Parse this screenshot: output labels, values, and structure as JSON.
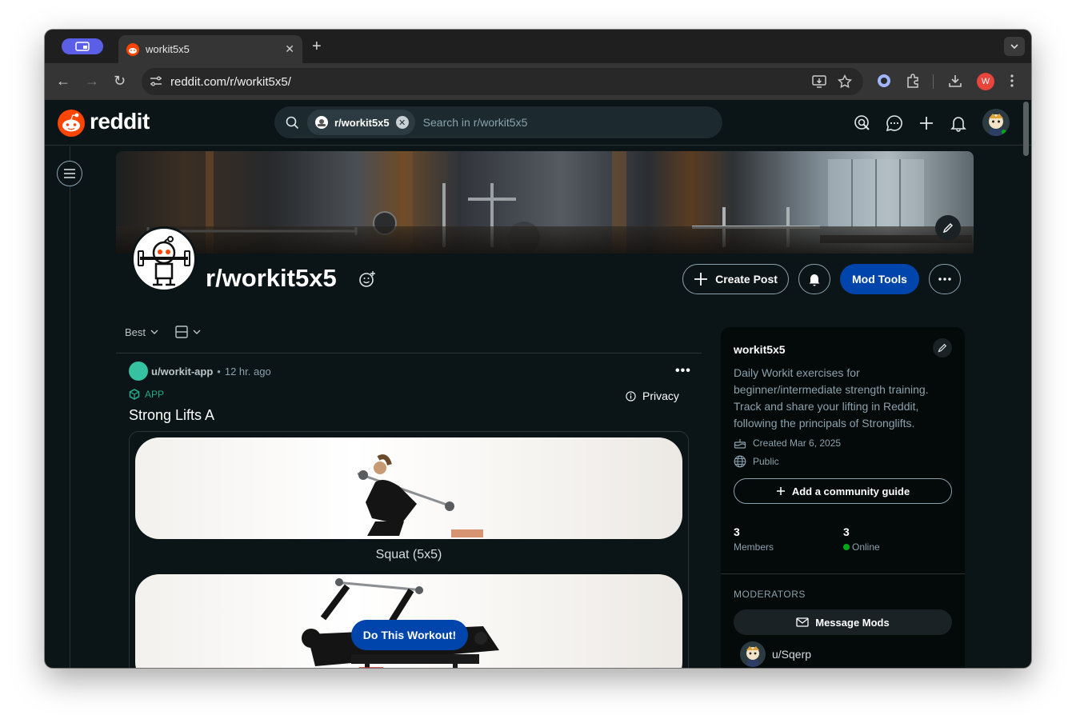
{
  "browser": {
    "tab_title": "workit5x5",
    "tab_close": "✕",
    "new_tab": "+",
    "back": "←",
    "forward": "→",
    "reload": "↻",
    "url": "reddit.com/r/workit5x5/",
    "profile_initial": "W"
  },
  "header": {
    "logo_text": "reddit",
    "search_chip": "r/workit5x5",
    "search_placeholder": "Search in r/workit5x5"
  },
  "community": {
    "title": "r/workit5x5",
    "create_post": "Create Post",
    "mod_tools": "Mod Tools"
  },
  "feed": {
    "sort_label": "Best"
  },
  "post": {
    "user": "u/workit-app",
    "time": "12 hr. ago",
    "app_tag": "APP",
    "privacy": "Privacy",
    "title": "Strong Lifts A",
    "exercises": [
      "Squat (5x5)"
    ],
    "cta": "Do This Workout!"
  },
  "sidebar": {
    "name": "workit5x5",
    "description": "Daily Workit exercises for beginner/intermediate strength training. Track and share your lifting in Reddit, following the principals of Stronglifts.",
    "created": "Created Mar 6, 2025",
    "visibility": "Public",
    "guide_button": "Add a community guide",
    "members_count": "3",
    "members_label": "Members",
    "online_count": "3",
    "online_label": "Online",
    "moderators_heading": "MODERATORS",
    "message_mods": "Message Mods",
    "moderator_name": "u/Sqerp"
  },
  "colors": {
    "accent_blue": "#0045ac",
    "reddit_orange": "#ff4500",
    "app_green": "#24a88a",
    "online_green": "#01a816"
  }
}
